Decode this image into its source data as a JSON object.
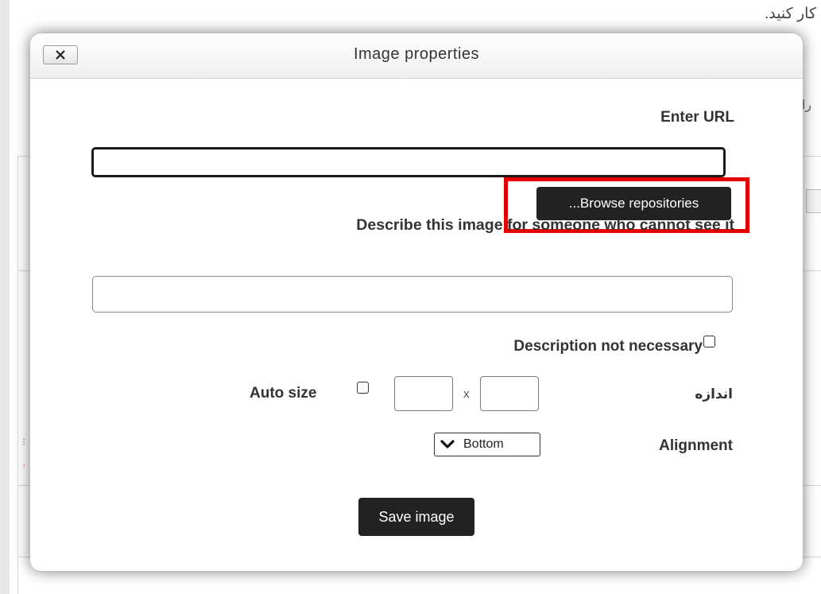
{
  "background": {
    "top_text": "کار کنید.",
    "right_glyph": "را"
  },
  "dialog": {
    "title": "Image properties",
    "close_icon": "close-icon",
    "url_label": "Enter URL",
    "url_value": "",
    "browse_button": "...Browse repositories",
    "highlight_color": "#e60000",
    "description_label": "Describe this image for someone who cannot see it",
    "description_value": "",
    "description_not_necessary_label": "Description not necessary",
    "description_not_necessary_checked": false,
    "auto_size_label": "Auto size",
    "auto_size_checked": false,
    "size_label": "اندازه",
    "size_separator": "x",
    "width_value": "",
    "height_value": "",
    "alignment_label": "Alignment",
    "alignment_value": "Bottom",
    "alignment_icon": "chevron-down-icon",
    "save_button": "Save image"
  }
}
